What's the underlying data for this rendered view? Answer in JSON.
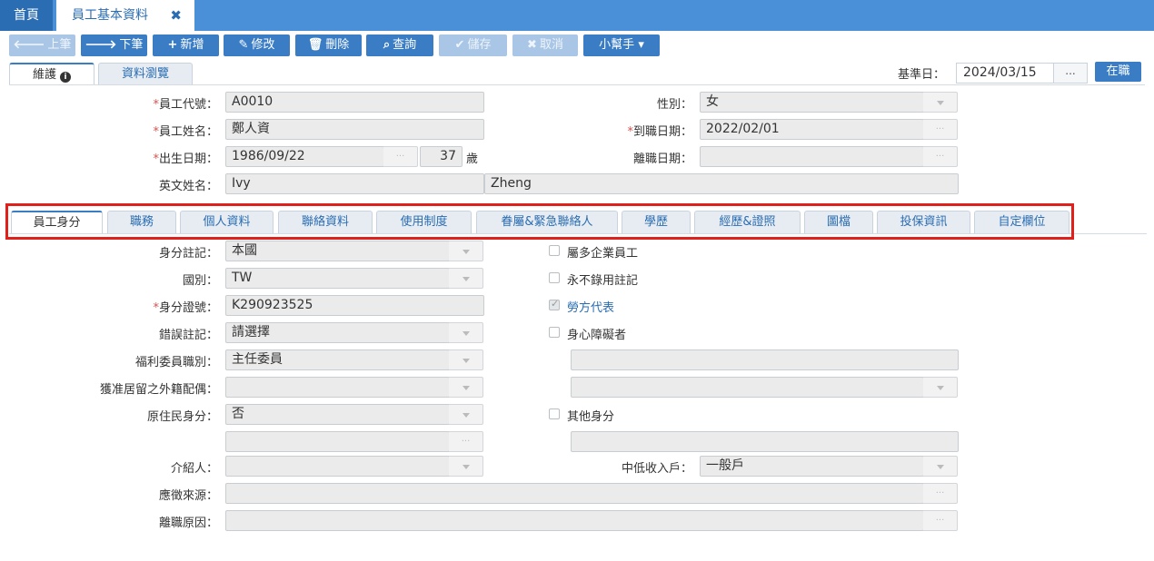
{
  "top_tabs": {
    "home": "首頁",
    "active": "員工基本資料",
    "close": "✖"
  },
  "toolbar": {
    "prev": "上筆",
    "next": "下筆",
    "add": "新增",
    "edit": "修改",
    "delete": "刪除",
    "query": "查詢",
    "save": "儲存",
    "cancel": "取消",
    "helper": "小幫手"
  },
  "icons": {
    "prev": "arrow-left-icon",
    "next": "arrow-right-icon",
    "add": "plus-icon",
    "edit": "pencil-icon",
    "delete": "trash-icon",
    "query": "search-icon",
    "save": "check-icon",
    "cancel": "x-icon"
  },
  "sub_tabs": {
    "maintain": "維護",
    "browse": "資料瀏覽"
  },
  "ref_date": {
    "label": "基準日：",
    "value": "2024/03/15",
    "button": "...",
    "status": "在職"
  },
  "form": {
    "emp_code": {
      "label": "員工代號：",
      "value": "A0010"
    },
    "emp_name": {
      "label": "員工姓名：",
      "value": "鄭人資"
    },
    "birth": {
      "label": "出生日期：",
      "value": "1986/09/22",
      "age": "37",
      "age_unit": "歲"
    },
    "eng_name": {
      "label": "英文姓名：",
      "first": "Ivy",
      "last": "Zheng"
    },
    "gender": {
      "label": "性別：",
      "value": "女"
    },
    "hire_date": {
      "label": "到職日期：",
      "value": "2022/02/01"
    },
    "leave_date": {
      "label": "離職日期：",
      "value": ""
    }
  },
  "section_tabs": [
    "員工身分",
    "職務",
    "個人資料",
    "聯絡資料",
    "使用制度",
    "眷屬&緊急聯絡人",
    "學歷",
    "經歷&證照",
    "圖檔",
    "投保資訊",
    "自定欄位"
  ],
  "identity": {
    "id_note": {
      "label": "身分註記：",
      "value": "本國"
    },
    "nationality": {
      "label": "國別：",
      "value": "TW"
    },
    "id_number": {
      "label": "身分證號：",
      "value": "K290923525"
    },
    "error_note": {
      "label": "錯誤註記：",
      "value": "請選擇"
    },
    "welfare_role": {
      "label": "福利委員職別：",
      "value": "主任委員"
    },
    "foreign_spouse": {
      "label": "獲准居留之外籍配偶：",
      "value": ""
    },
    "aboriginal": {
      "label": "原住民身分：",
      "value": "否"
    },
    "referrer": {
      "label": "介紹人：",
      "value": ""
    },
    "applicant_source": {
      "label": "應徵來源：",
      "value": ""
    },
    "leave_reason": {
      "label": "離職原因：",
      "value": ""
    },
    "low_income": {
      "label": "中低收入戶：",
      "value": "一般戶"
    },
    "multi_company": {
      "label": "屬多企業員工",
      "checked": false
    },
    "never_hire": {
      "label": "永不錄用註記",
      "checked": false
    },
    "labor_rep": {
      "label": "勞方代表",
      "checked": true
    },
    "disabled": {
      "label": "身心障礙者",
      "checked": false
    },
    "other_identity": {
      "label": "其他身分",
      "checked": false
    }
  }
}
